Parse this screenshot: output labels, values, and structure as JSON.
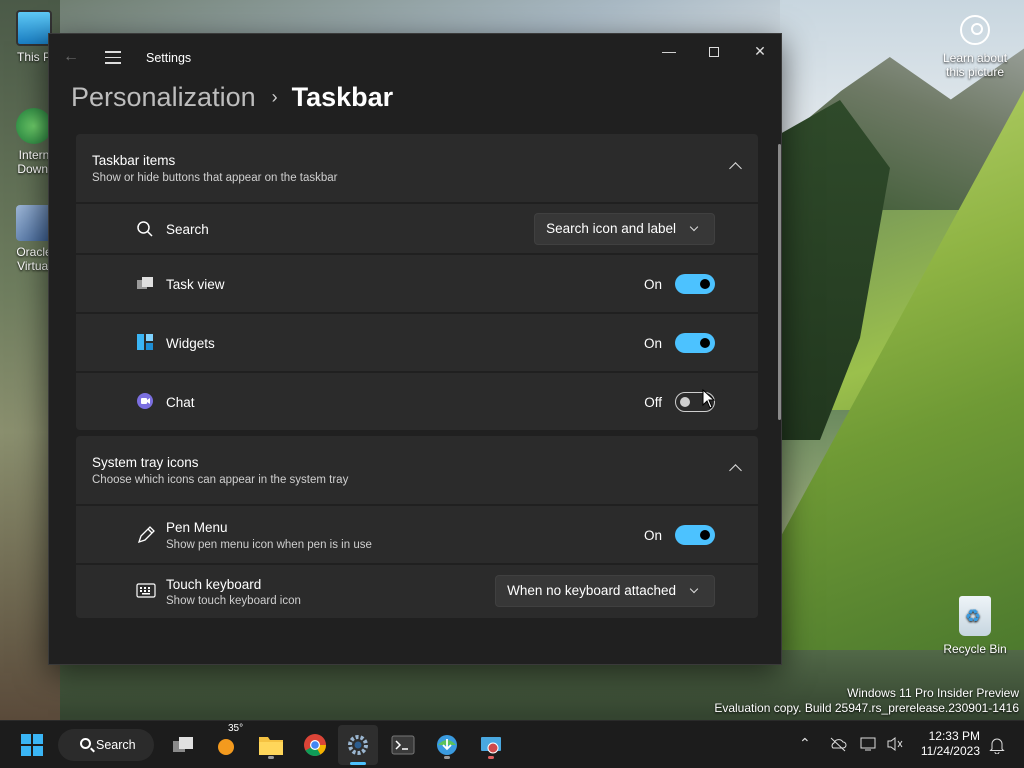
{
  "desktop": {
    "icons": [
      {
        "label": "This P"
      },
      {
        "label_line1": "Intern",
        "label_line2": "Downl"
      },
      {
        "label_line1": "Oracle",
        "label_line2": "Virtual"
      }
    ],
    "learn_line1": "Learn about",
    "learn_line2": "this picture",
    "recycle_bin": "Recycle Bin",
    "watermark_line1": "Windows 11 Pro Insider Preview",
    "watermark_line2": "Evaluation copy. Build 25947.rs_prerelease.230901-1416"
  },
  "window": {
    "title": "Settings",
    "breadcrumb_parent": "Personalization",
    "breadcrumb_sep": "›",
    "breadcrumb_current": "Taskbar"
  },
  "taskbar_items": {
    "title": "Taskbar items",
    "subtitle": "Show or hide buttons that appear on the taskbar",
    "search": {
      "label": "Search",
      "value": "Search icon and label"
    },
    "task_view": {
      "label": "Task view",
      "state": "On",
      "on": true
    },
    "widgets": {
      "label": "Widgets",
      "state": "On",
      "on": true
    },
    "chat": {
      "label": "Chat",
      "state": "Off",
      "on": false
    }
  },
  "system_tray": {
    "title": "System tray icons",
    "subtitle": "Choose which icons can appear in the system tray",
    "pen_menu": {
      "label": "Pen Menu",
      "sublabel": "Show pen menu icon when pen is in use",
      "state": "On",
      "on": true
    },
    "touch_keyboard": {
      "label": "Touch keyboard",
      "sublabel": "Show touch keyboard icon",
      "value": "When no keyboard attached"
    }
  },
  "taskbar": {
    "search_label": "Search",
    "weather_temp": "35°",
    "time": "12:33 PM",
    "date": "11/24/2023"
  },
  "colors": {
    "accent": "#4cc2ff",
    "window_bg": "#202020",
    "card_bg": "#2b2b2b"
  }
}
